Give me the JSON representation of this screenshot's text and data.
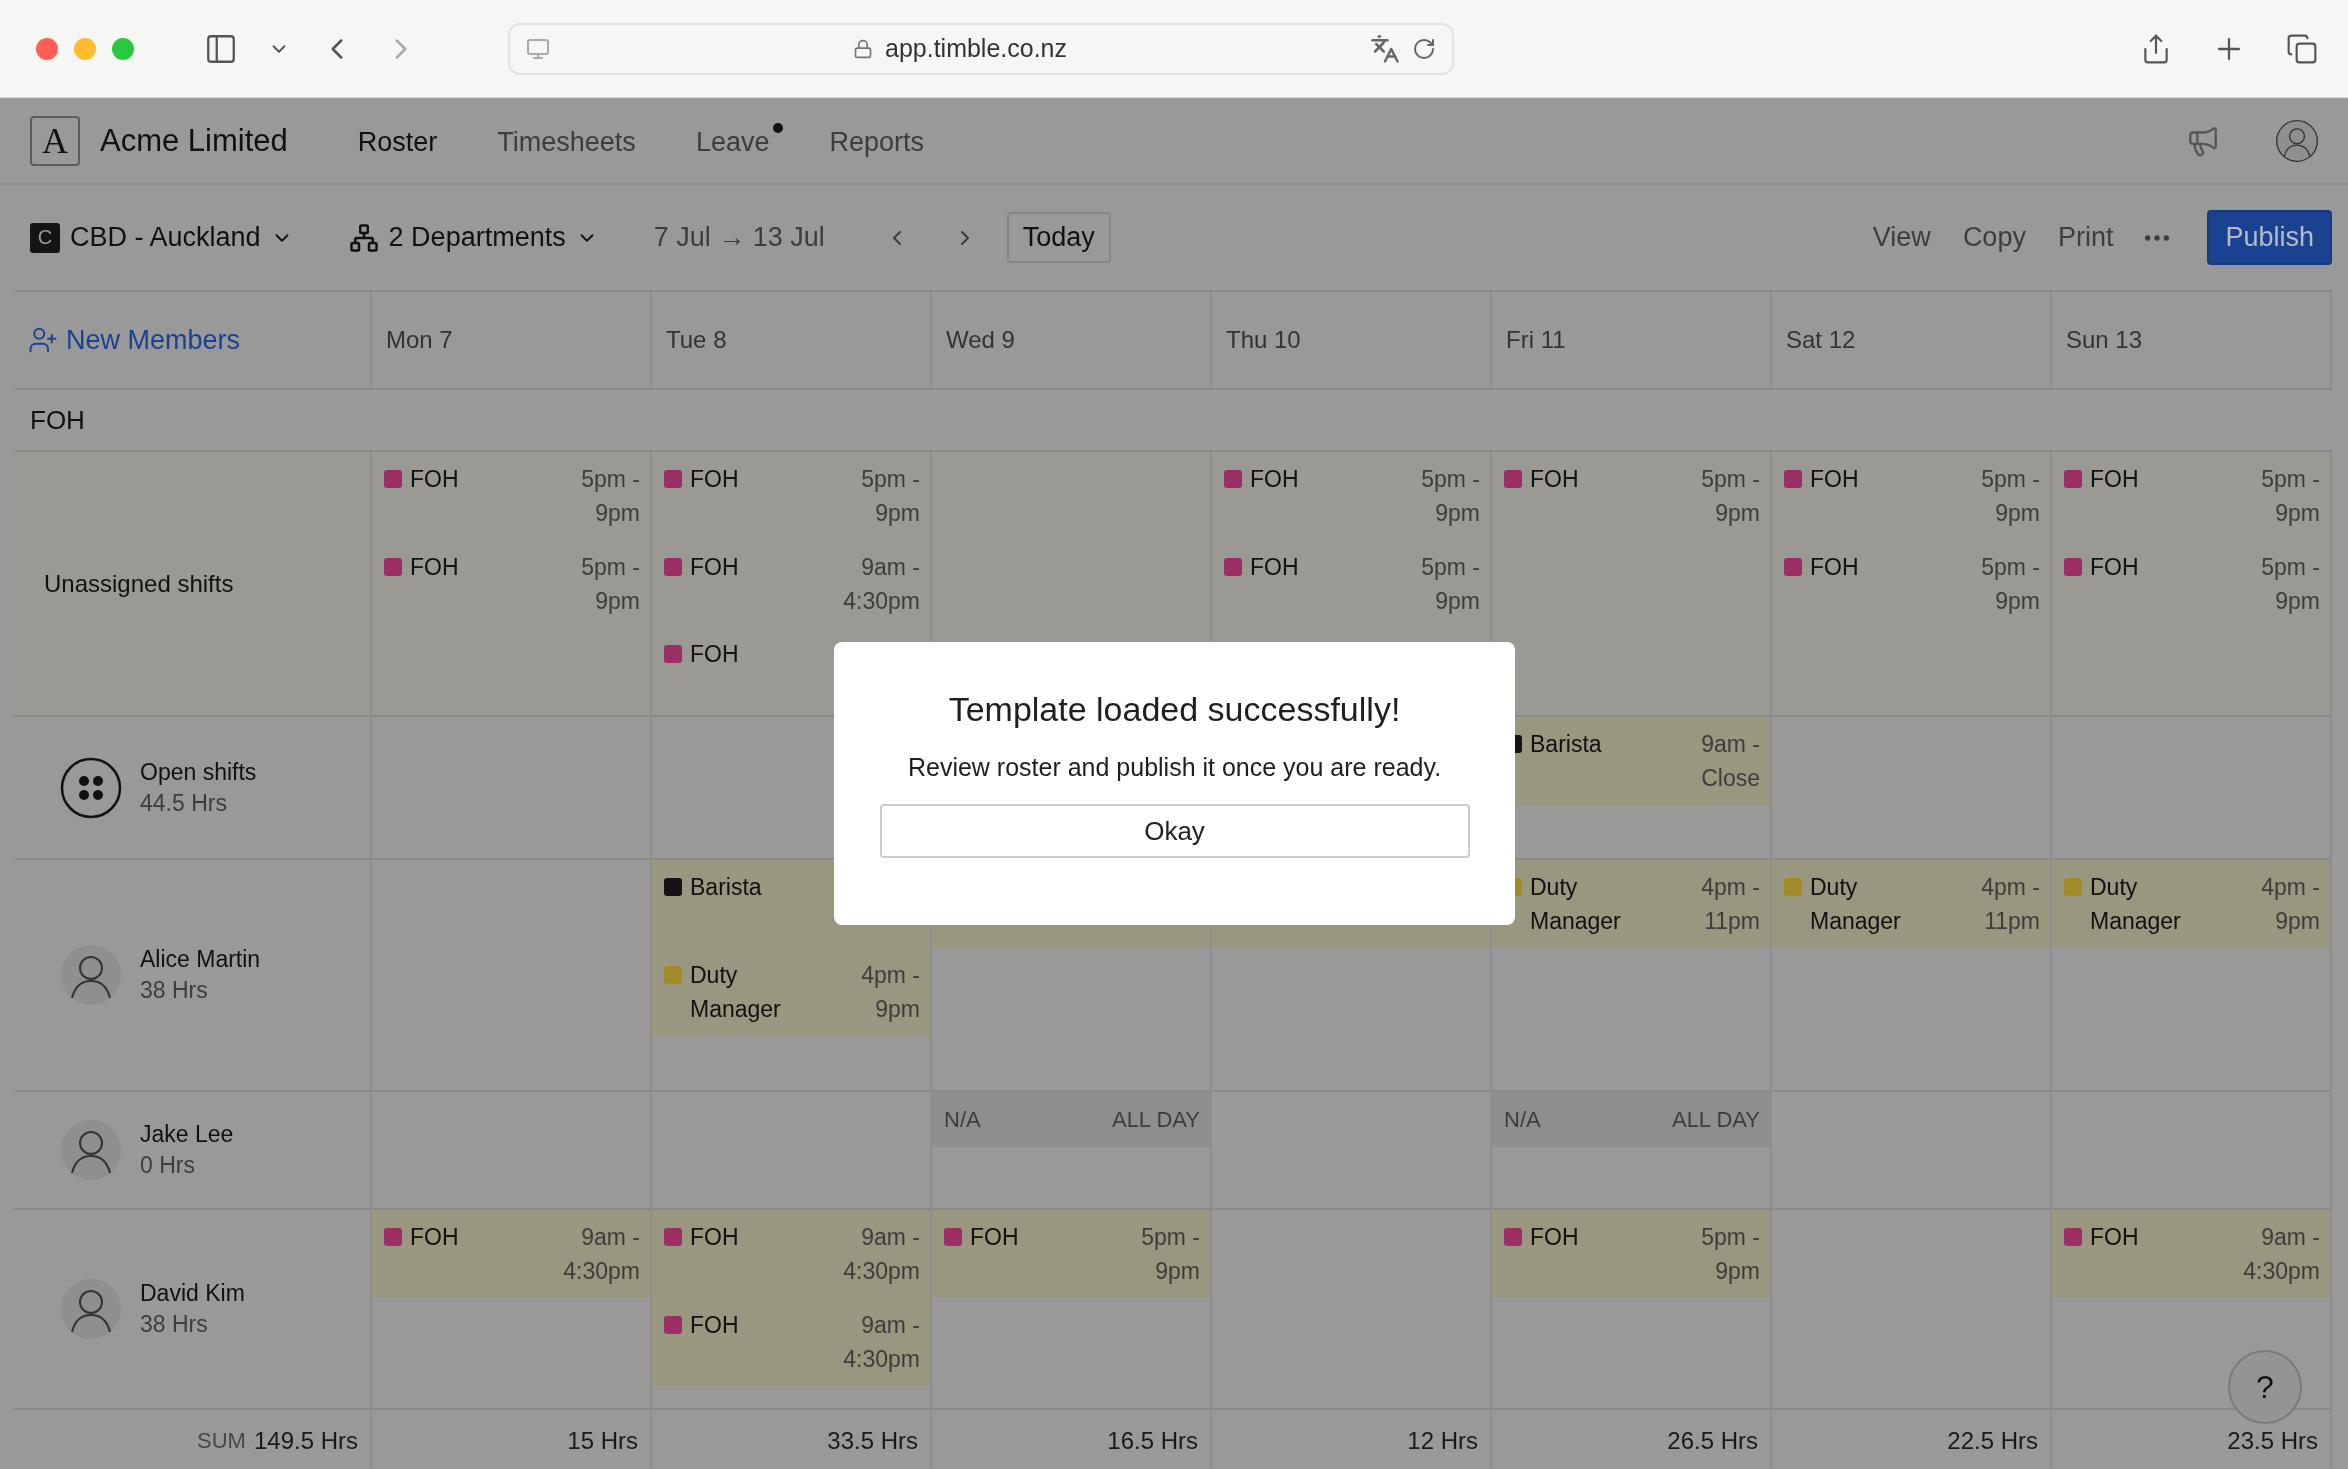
{
  "browser": {
    "url": "app.timble.co.nz"
  },
  "app": {
    "logo": "A",
    "company": "Acme Limited",
    "nav": [
      {
        "label": "Roster",
        "selected": true,
        "notification": false
      },
      {
        "label": "Timesheets",
        "selected": false,
        "notification": false
      },
      {
        "label": "Leave",
        "selected": false,
        "notification": true
      },
      {
        "label": "Reports",
        "selected": false,
        "notification": false
      }
    ]
  },
  "toolbar": {
    "location_badge": "C",
    "location": "CBD - Auckland",
    "departments": "2 Departments",
    "date_range": "7 Jul → 13 Jul",
    "today": "Today",
    "actions": [
      "View",
      "Copy",
      "Print"
    ],
    "publish": "Publish"
  },
  "roster": {
    "new_members": "New Members",
    "days": [
      "Mon 7",
      "Tue 8",
      "Wed 9",
      "Thu 10",
      "Fri 11",
      "Sat 12",
      "Sun 13"
    ],
    "section": "FOH",
    "rows": [
      {
        "kind": "unassigned",
        "name": "Unassigned shifts",
        "cells": [
          [
            {
              "kind": "full",
              "label": "FOH",
              "time": "5pm - 9pm",
              "color": "#9b2f63"
            },
            {
              "kind": "full",
              "label": "FOH",
              "time": "5pm - 9pm",
              "color": "#9b2f63"
            }
          ],
          [
            {
              "kind": "full",
              "label": "FOH",
              "time": "5pm - 9pm",
              "color": "#9b2f63"
            },
            {
              "kind": "full",
              "label": "FOH",
              "time": "9am - 4:30pm",
              "color": "#9b2f63"
            },
            {
              "kind": "label-only",
              "label": "FOH",
              "color": "#9b2f63"
            }
          ],
          [],
          [
            {
              "kind": "full",
              "label": "FOH",
              "time": "5pm - 9pm",
              "color": "#9b2f63"
            },
            {
              "kind": "full",
              "label": "FOH",
              "time": "5pm - 9pm",
              "color": "#9b2f63"
            }
          ],
          [
            {
              "kind": "full",
              "label": "FOH",
              "time": "5pm - 9pm",
              "color": "#9b2f63"
            }
          ],
          [
            {
              "kind": "full",
              "label": "FOH",
              "time": "5pm - 9pm",
              "color": "#9b2f63"
            },
            {
              "kind": "full",
              "label": "FOH",
              "time": "5pm - 9pm",
              "color": "#9b2f63"
            }
          ],
          [
            {
              "kind": "full",
              "label": "FOH",
              "time": "5pm - 9pm",
              "color": "#9b2f63"
            },
            {
              "kind": "full",
              "label": "FOH",
              "time": "5pm - 9pm",
              "color": "#9b2f63"
            }
          ]
        ]
      },
      {
        "kind": "open",
        "name": "Open shifts",
        "hours": "44.5 Hrs",
        "cells": [
          [],
          [],
          [],
          [],
          [
            {
              "kind": "full",
              "label": "Barista",
              "time": "9am - Close",
              "color": "#141414"
            }
          ],
          [],
          []
        ]
      },
      {
        "kind": "member",
        "name": "Alice Martin",
        "hours": "38 Hrs",
        "cells": [
          [],
          [
            {
              "kind": "label-only",
              "label": "Barista",
              "color": "#141414"
            },
            {
              "kind": "full",
              "label": "Duty Manager",
              "time": "4pm - 9pm",
              "color": "#a08a2a"
            }
          ],
          [
            {
              "kind": "covered"
            }
          ],
          [
            {
              "kind": "covered"
            }
          ],
          [
            {
              "kind": "full",
              "label": "Duty Manager",
              "time": "4pm - 11pm",
              "color": "#a08a2a"
            }
          ],
          [
            {
              "kind": "full",
              "label": "Duty Manager",
              "time": "4pm - 11pm",
              "color": "#a08a2a"
            }
          ],
          [
            {
              "kind": "full",
              "label": "Duty Manager",
              "time": "4pm - 9pm",
              "color": "#a08a2a"
            }
          ]
        ]
      },
      {
        "kind": "member",
        "name": "Jake Lee",
        "hours": "0 Hrs",
        "cells": [
          [],
          [],
          [
            {
              "kind": "unavailable",
              "label": "N/A",
              "time": "ALL DAY"
            }
          ],
          [],
          [
            {
              "kind": "unavailable",
              "label": "N/A",
              "time": "ALL DAY"
            }
          ],
          [],
          []
        ]
      },
      {
        "kind": "member",
        "name": "David Kim",
        "hours": "38 Hrs",
        "cells": [
          [
            {
              "kind": "full",
              "label": "FOH",
              "time": "9am - 4:30pm",
              "color": "#9b2f63"
            }
          ],
          [
            {
              "kind": "full",
              "label": "FOH",
              "time": "9am - 4:30pm",
              "color": "#9b2f63"
            },
            {
              "kind": "full",
              "label": "FOH",
              "time": "9am - 4:30pm",
              "color": "#9b2f63"
            }
          ],
          [
            {
              "kind": "full",
              "label": "FOH",
              "time": "5pm - 9pm",
              "color": "#9b2f63"
            }
          ],
          [],
          [
            {
              "kind": "full",
              "label": "FOH",
              "time": "5pm - 9pm",
              "color": "#9b2f63"
            }
          ],
          [],
          [
            {
              "kind": "full",
              "label": "FOH",
              "time": "9am - 4:30pm",
              "color": "#9b2f63"
            }
          ]
        ]
      }
    ],
    "totals": {
      "label": "SUM",
      "total": "149.5 Hrs",
      "days": [
        "15 Hrs",
        "33.5 Hrs",
        "16.5 Hrs",
        "12 Hrs",
        "26.5 Hrs",
        "22.5 Hrs",
        "23.5 Hrs"
      ]
    }
  },
  "modal": {
    "title": "Template loaded successfully!",
    "message": "Review roster and publish it once you are ready.",
    "button": "Okay"
  },
  "help": "?"
}
